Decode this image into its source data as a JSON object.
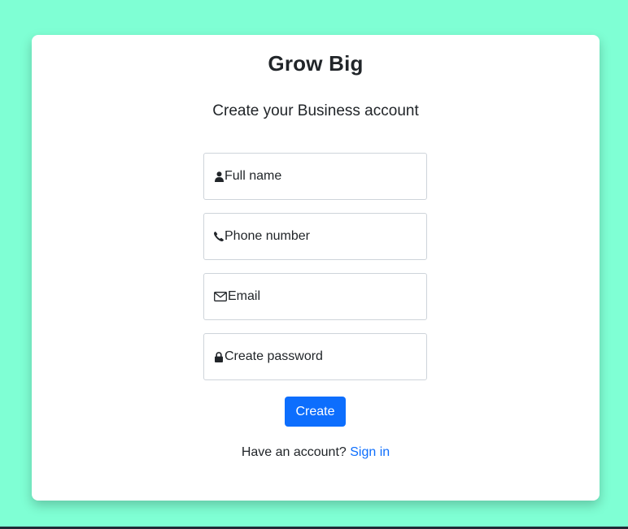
{
  "app": {
    "title": "Grow Big",
    "subtitle": "Create your Business account"
  },
  "form": {
    "fields": [
      {
        "icon": "user-icon",
        "placeholder": "Full name"
      },
      {
        "icon": "phone-icon",
        "placeholder": "Phone number"
      },
      {
        "icon": "envelope-icon",
        "placeholder": "Email"
      },
      {
        "icon": "lock-icon",
        "placeholder": "Create password"
      }
    ],
    "submit_label": "Create"
  },
  "signin": {
    "prompt": "Have an account?",
    "link_label": "Sign in"
  },
  "colors": {
    "background": "#7fffd4",
    "card": "#ffffff",
    "primary": "#0d6efd",
    "text": "#212529"
  }
}
